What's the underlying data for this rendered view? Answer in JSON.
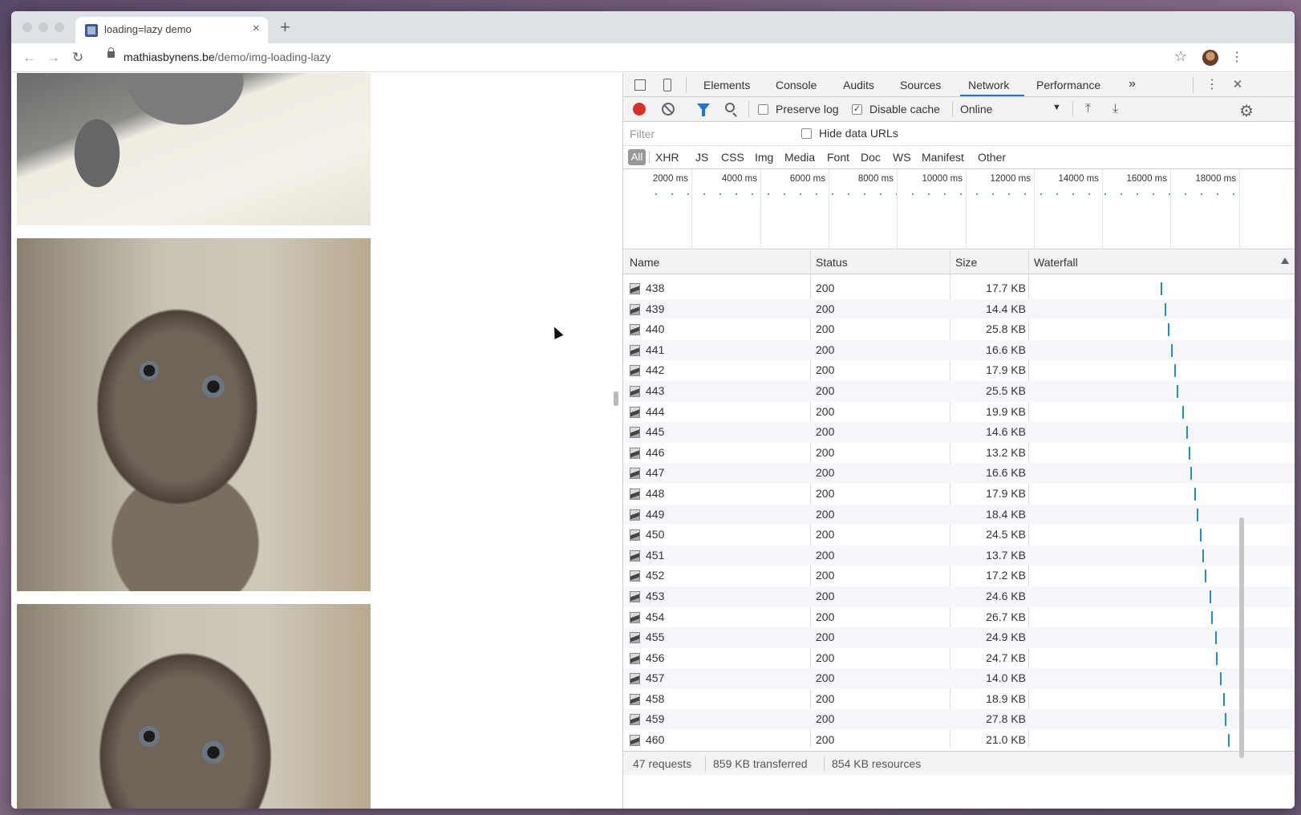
{
  "browser": {
    "tab_title": "loading=lazy demo",
    "tab_close": "×",
    "new_tab": "+",
    "url_host": "mathiasbynens.be",
    "url_path": "/demo/img-loading-lazy"
  },
  "devtools": {
    "tabs": [
      "Elements",
      "Console",
      "Audits",
      "Sources",
      "Network",
      "Performance"
    ],
    "active_tab": "Network",
    "more_tabs": "»",
    "close": "✕",
    "toolbar": {
      "preserve_log_label": "Preserve log",
      "preserve_log_checked": false,
      "disable_cache_label": "Disable cache",
      "disable_cache_checked": true,
      "throttling": "Online"
    },
    "filter": {
      "placeholder": "Filter",
      "hide_data_urls_label": "Hide data URLs"
    },
    "resource_types": [
      "All",
      "XHR",
      "JS",
      "CSS",
      "Img",
      "Media",
      "Font",
      "Doc",
      "WS",
      "Manifest",
      "Other"
    ],
    "overview_ticks": [
      "2000 ms",
      "4000 ms",
      "6000 ms",
      "8000 ms",
      "10000 ms",
      "12000 ms",
      "14000 ms",
      "16000 ms",
      "18000 ms"
    ],
    "columns": {
      "name": "Name",
      "status": "Status",
      "size": "Size",
      "waterfall": "Waterfall"
    },
    "requests": [
      {
        "name": "438",
        "status": "200",
        "size": "17.7 KB",
        "wf": 0.62
      },
      {
        "name": "439",
        "status": "200",
        "size": "14.4 KB",
        "wf": 0.636
      },
      {
        "name": "440",
        "status": "200",
        "size": "25.8 KB",
        "wf": 0.654
      },
      {
        "name": "441",
        "status": "200",
        "size": "16.6 KB",
        "wf": 0.668
      },
      {
        "name": "442",
        "status": "200",
        "size": "17.9 KB",
        "wf": 0.684
      },
      {
        "name": "443",
        "status": "200",
        "size": "25.5 KB",
        "wf": 0.696
      },
      {
        "name": "444",
        "status": "200",
        "size": "19.9 KB",
        "wf": 0.72
      },
      {
        "name": "445",
        "status": "200",
        "size": "14.6 KB",
        "wf": 0.74
      },
      {
        "name": "446",
        "status": "200",
        "size": "13.2 KB",
        "wf": 0.75
      },
      {
        "name": "447",
        "status": "200",
        "size": "16.6 KB",
        "wf": 0.758
      },
      {
        "name": "448",
        "status": "200",
        "size": "17.9 KB",
        "wf": 0.778
      },
      {
        "name": "449",
        "status": "200",
        "size": "18.4 KB",
        "wf": 0.79
      },
      {
        "name": "450",
        "status": "200",
        "size": "24.5 KB",
        "wf": 0.806
      },
      {
        "name": "451",
        "status": "200",
        "size": "13.7 KB",
        "wf": 0.816
      },
      {
        "name": "452",
        "status": "200",
        "size": "17.2 KB",
        "wf": 0.83
      },
      {
        "name": "453",
        "status": "200",
        "size": "24.6 KB",
        "wf": 0.85
      },
      {
        "name": "454",
        "status": "200",
        "size": "26.7 KB",
        "wf": 0.86
      },
      {
        "name": "455",
        "status": "200",
        "size": "24.9 KB",
        "wf": 0.876
      },
      {
        "name": "456",
        "status": "200",
        "size": "24.7 KB",
        "wf": 0.882
      },
      {
        "name": "457",
        "status": "200",
        "size": "14.0 KB",
        "wf": 0.9
      },
      {
        "name": "458",
        "status": "200",
        "size": "18.9 KB",
        "wf": 0.916
      },
      {
        "name": "459",
        "status": "200",
        "size": "27.8 KB",
        "wf": 0.922
      },
      {
        "name": "460",
        "status": "200",
        "size": "21.0 KB",
        "wf": 0.94
      }
    ],
    "summary": {
      "requests": "47 requests",
      "transferred": "859 KB transferred",
      "resources": "854 KB resources"
    }
  }
}
